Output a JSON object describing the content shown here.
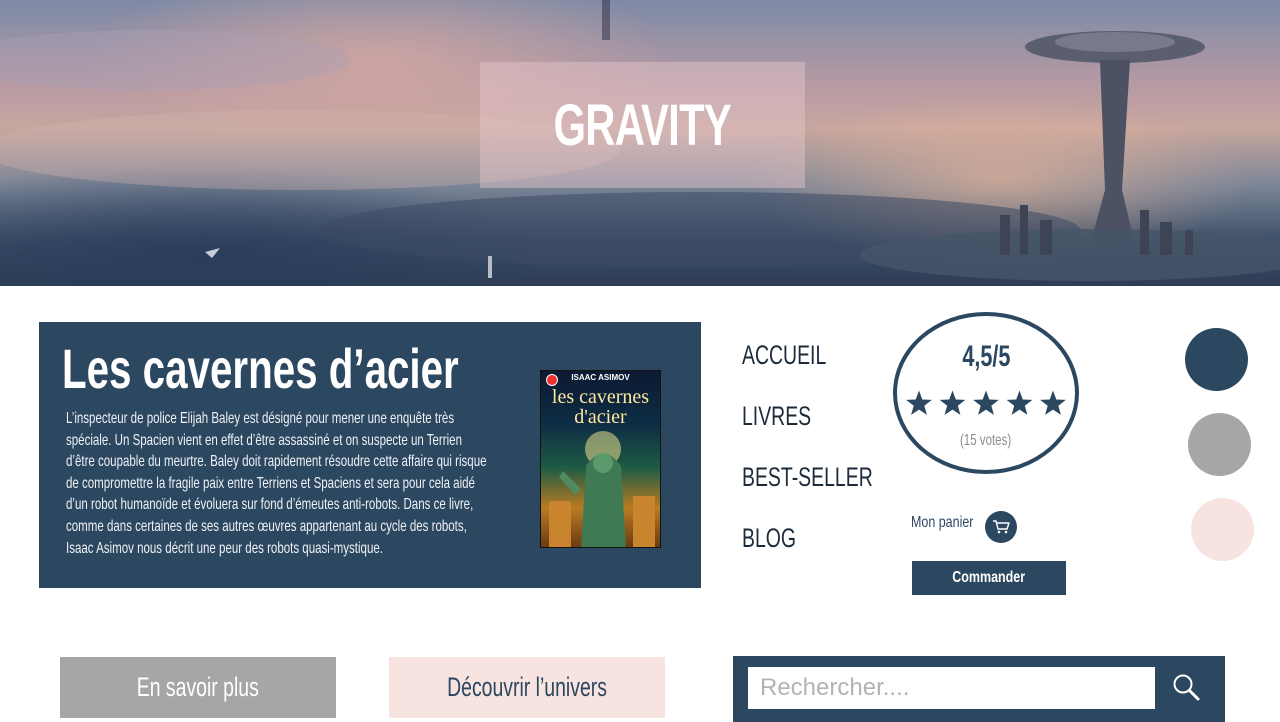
{
  "hero": {
    "title": "GRAVITY"
  },
  "book": {
    "title": "Les cavernes d’acier",
    "description": "L’inspecteur de police Elijah Baley est désigné pour mener une enquête très spéciale. Un Spacien vient en effet d’être assassiné et on suspecte un Terrien d’être coupable du meurtre. Baley doit rapidement résoudre cette affaire qui risque de compromettre la fragile paix entre Terriens et Spaciens et sera pour cela aidé d’un robot humanoïde et évoluera sur fond d’émeutes anti-robots. Dans ce livre, comme dans certaines de ses autres œuvres appartenant au cycle des robots, Isaac Asimov nous décrit une peur des robots quasi-mystique.",
    "cover": {
      "author": "ISAAC ASIMOV",
      "title": "les cavernes d'acier"
    }
  },
  "nav": {
    "items": [
      {
        "label": "ACCUEIL"
      },
      {
        "label": "LIVRES"
      },
      {
        "label": "BEST-SELLER"
      },
      {
        "label": "BLOG"
      }
    ]
  },
  "rating": {
    "score": "4,5/5",
    "stars": 5,
    "votes": "(15 votes)"
  },
  "cart": {
    "label": "Mon panier",
    "order_label": "Commander"
  },
  "swatches": {
    "colors": [
      "#2c4760",
      "#a6a6a6",
      "#f7e4e0"
    ]
  },
  "actions": {
    "more_label": "En savoir plus",
    "discover_label": "Découvrir l’univers"
  },
  "search": {
    "placeholder": "Rechercher...."
  },
  "icons": {
    "cart": "cart-icon",
    "search": "search-icon",
    "star": "star-icon"
  }
}
